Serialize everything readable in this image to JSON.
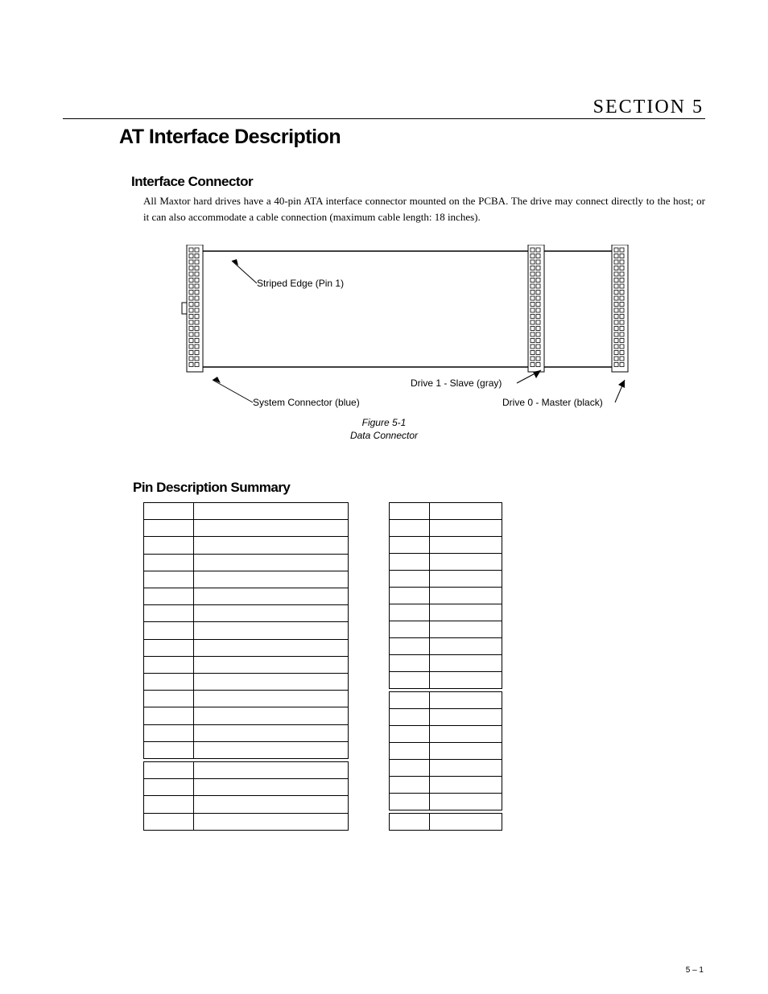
{
  "section_label": "SECTION 5",
  "title": "AT Interface Description",
  "heading_connector": "Interface Connector",
  "para": "All Maxtor hard drives have a 40-pin ATA interface connector mounted on the PCBA. The drive may connect directly to the host; or it can also accommodate a cable connection (maximum cable length: 18 inches).",
  "figure": {
    "stripe_label": "Striped Edge (Pin 1)",
    "system_label": "System Connector (blue)",
    "slave_label": "Drive 1 - Slave (gray)",
    "master_label": "Drive 0 - Master (black)",
    "caption_line1": "Figure 5-1",
    "caption_line2": "Data Connector"
  },
  "heading_pins": "Pin Description Summary",
  "table_left": {
    "group_a_rows": 15,
    "spacer": true,
    "group_b_rows": 4
  },
  "table_right": {
    "group_a_rows": 11,
    "spacer": true,
    "group_b_rows": 7,
    "spacer2": true,
    "group_c_rows": 1
  },
  "footer": "5 – 1"
}
